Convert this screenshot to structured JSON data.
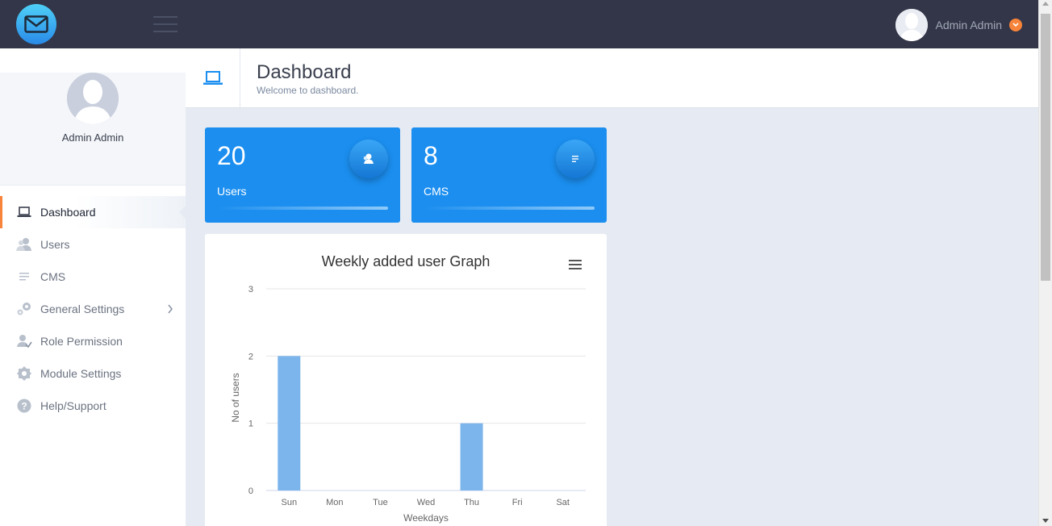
{
  "topbar": {
    "user_name": "Admin Admin"
  },
  "sidebar": {
    "profile_name": "Admin Admin",
    "items": [
      {
        "label": "Dashboard",
        "icon": "laptop-icon"
      },
      {
        "label": "Users",
        "icon": "users-icon"
      },
      {
        "label": "CMS",
        "icon": "document-icon"
      },
      {
        "label": "General Settings",
        "icon": "gears-icon"
      },
      {
        "label": "Role Permission",
        "icon": "user-check-icon"
      },
      {
        "label": "Module Settings",
        "icon": "cog-icon"
      },
      {
        "label": "Help/Support",
        "icon": "help-icon"
      }
    ]
  },
  "header": {
    "title": "Dashboard",
    "subtitle": "Welcome to dashboard."
  },
  "cards": [
    {
      "value": "20",
      "label": "Users"
    },
    {
      "value": "8",
      "label": "CMS"
    }
  ],
  "colors": {
    "topbar": "#323648",
    "accent": "#1b8eef",
    "active_border": "#f7843a",
    "bar": "#7cb5ec"
  },
  "chart_data": {
    "type": "bar",
    "title": "Weekly added user Graph",
    "xlabel": "Weekdays",
    "ylabel": "No of users",
    "categories": [
      "Sun",
      "Mon",
      "Tue",
      "Wed",
      "Thu",
      "Fri",
      "Sat"
    ],
    "values": [
      2,
      0,
      0,
      0,
      1,
      0,
      0
    ],
    "yticks": [
      "0",
      "1",
      "2",
      "3"
    ],
    "ylim": [
      0,
      3
    ],
    "grid": true
  }
}
